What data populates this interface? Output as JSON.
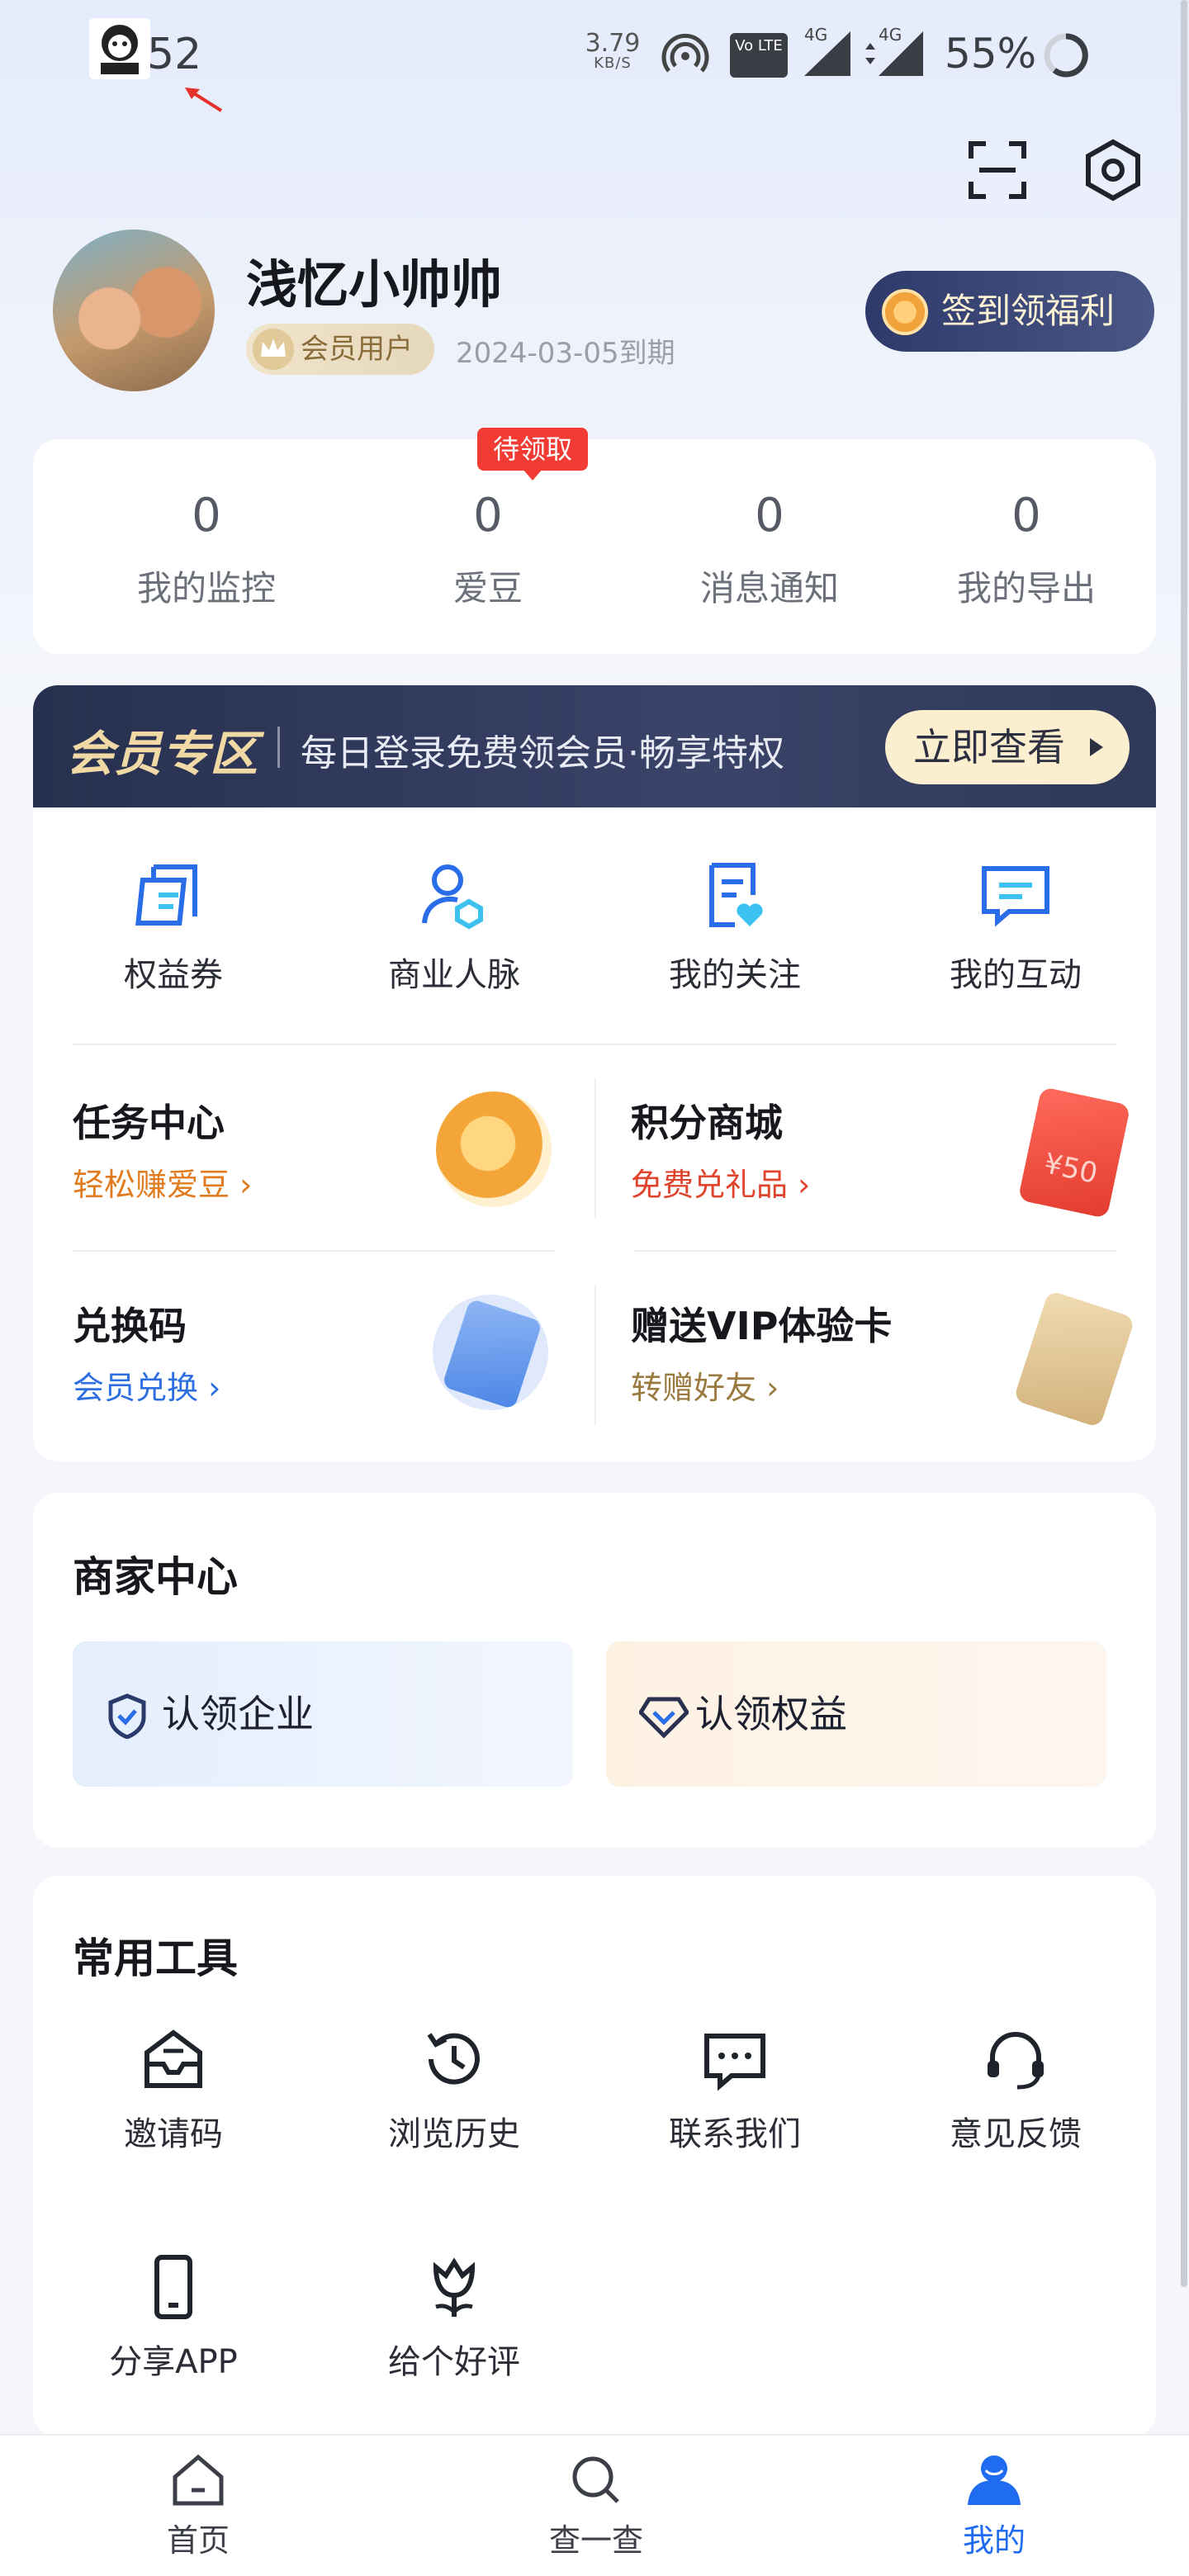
{
  "status_bar": {
    "time": "52",
    "net_speed_value": "3.79",
    "net_speed_unit": "KB/S",
    "volte_label": "Vo LTE",
    "sim1_label": "4G",
    "sim2_label": "4G",
    "battery": "55%"
  },
  "profile": {
    "username": "浅忆小帅帅",
    "member_badge": "会员用户",
    "expiry": "2024-03-05到期",
    "signin_button": "签到领福利"
  },
  "stats": {
    "pending_tag": "待领取",
    "items": [
      {
        "value": "0",
        "label": "我的监控"
      },
      {
        "value": "0",
        "label": "爱豆"
      },
      {
        "value": "0",
        "label": "消息通知"
      },
      {
        "value": "0",
        "label": "我的导出"
      }
    ]
  },
  "member_zone": {
    "title": "会员专区",
    "description": "每日登录免费领会员·畅享特权",
    "button": "立即查看"
  },
  "quick_entries": [
    {
      "label": "权益券",
      "icon": "coupon-icon"
    },
    {
      "label": "商业人脉",
      "icon": "contacts-icon"
    },
    {
      "label": "我的关注",
      "icon": "favorites-icon"
    },
    {
      "label": "我的互动",
      "icon": "chat-bubble-icon"
    }
  ],
  "features": [
    {
      "title": "任务中心",
      "subtitle": "轻松赚爱豆",
      "icon": "coin-stack-icon",
      "color": "#e07b1f"
    },
    {
      "title": "积分商城",
      "subtitle": "免费兑礼品",
      "icon": "gift-card-icon",
      "color": "#e0442d"
    },
    {
      "title": "兑换码",
      "subtitle": "会员兑换",
      "icon": "exchange-card-icon",
      "color": "#2d6fe0"
    },
    {
      "title": "赠送VIP体验卡",
      "subtitle": "转赠好友",
      "icon": "vip-card-icon",
      "color": "#9a7a3e"
    }
  ],
  "gift_card_value": "¥50",
  "merchant_center": {
    "title": "商家中心",
    "claim_company": "认领企业",
    "claim_rights": "认领权益"
  },
  "tools": {
    "title": "常用工具",
    "items": [
      {
        "label": "邀请码",
        "icon": "invite-mail-icon"
      },
      {
        "label": "浏览历史",
        "icon": "history-icon"
      },
      {
        "label": "联系我们",
        "icon": "message-icon"
      },
      {
        "label": "意见反馈",
        "icon": "headset-icon"
      },
      {
        "label": "分享APP",
        "icon": "phone-icon"
      },
      {
        "label": "给个好评",
        "icon": "flower-icon"
      }
    ]
  },
  "bottom_nav": [
    {
      "label": "首页",
      "icon": "home-icon",
      "active": false
    },
    {
      "label": "查一查",
      "icon": "search-icon",
      "active": false
    },
    {
      "label": "我的",
      "icon": "profile-icon",
      "active": true
    }
  ],
  "colors": {
    "accent": "#1f6cf0",
    "member_band": "#2f3858",
    "gold": "#f1d9a6",
    "tag_red": "#f23b33"
  }
}
